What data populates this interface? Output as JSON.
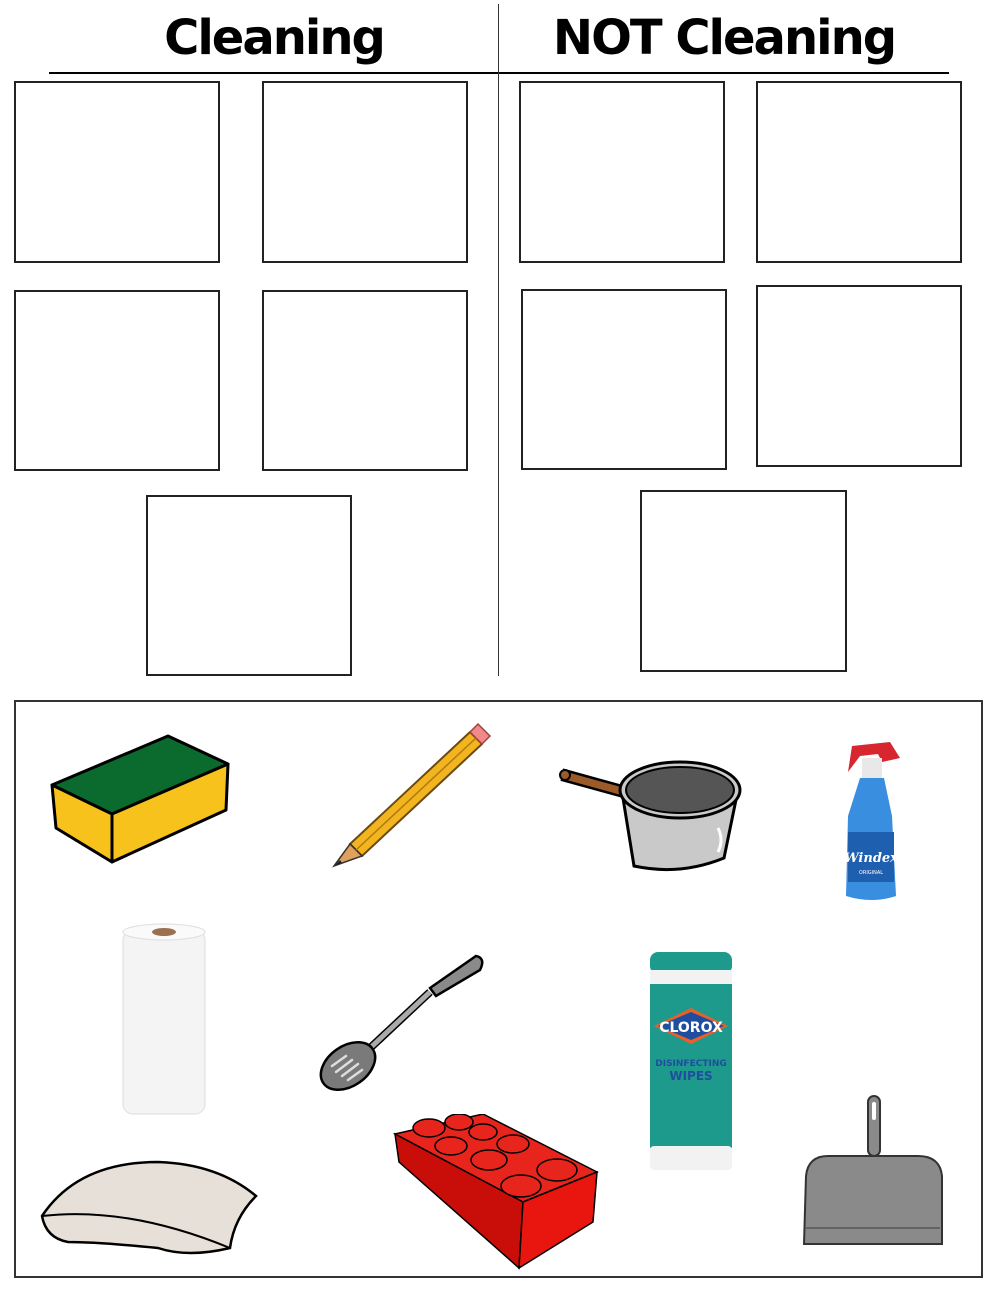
{
  "worksheet": {
    "columns": [
      {
        "title": "Cleaning",
        "drop_slots": 5
      },
      {
        "title": "NOT Cleaning",
        "drop_slots": 5
      }
    ]
  },
  "item_bank": {
    "items": [
      {
        "name": "sponge",
        "label": ""
      },
      {
        "name": "pencil",
        "label": ""
      },
      {
        "name": "pot",
        "label": ""
      },
      {
        "name": "spray-bottle",
        "label": "Windex",
        "sublabel": "ORIGINAL"
      },
      {
        "name": "paper-towel",
        "label": ""
      },
      {
        "name": "slotted-spoon",
        "label": ""
      },
      {
        "name": "disinfecting-wipes",
        "label": "CLOROX",
        "sublabel1": "DISINFECTING",
        "sublabel2": "WIPES"
      },
      {
        "name": "pillow",
        "label": ""
      },
      {
        "name": "lego-brick",
        "label": ""
      },
      {
        "name": "dustpan",
        "label": ""
      }
    ]
  },
  "colors": {
    "sponge_top": "#0b6b2e",
    "sponge_side": "#f7c21b",
    "pencil": "#f3b51f",
    "pot_body": "#c9c9c9",
    "pot_inner": "#555555",
    "pot_handle": "#9b5a2a",
    "windex_blue": "#3a8ee0",
    "windex_trigger": "#d8262f",
    "clorox_teal": "#1d9a8c",
    "lego_red": "#d9160f",
    "dustpan_gray": "#8a8a8a",
    "pillow": "#e6e0d8"
  }
}
